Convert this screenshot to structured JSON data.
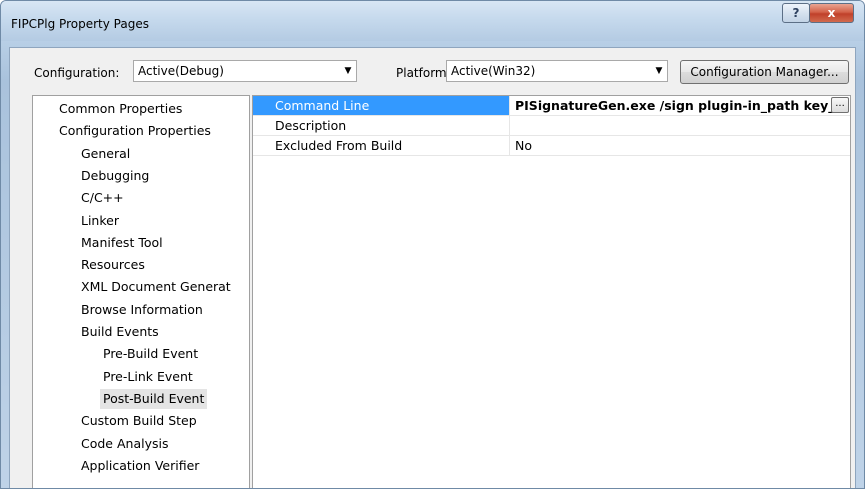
{
  "window": {
    "title": "FIPCPlg Property Pages",
    "help_glyph": "?",
    "close_glyph": "x"
  },
  "toolbar": {
    "configuration_label": "Configuration:",
    "configuration_value": "Active(Debug)",
    "platform_label": "Platform:",
    "platform_value": "Active(Win32)",
    "dropdown_arrow": "▼",
    "manager_button": "Configuration Manager..."
  },
  "tree": {
    "items": [
      {
        "label": "Common Properties",
        "level": 0
      },
      {
        "label": "Configuration Properties",
        "level": 0
      },
      {
        "label": "General",
        "level": 1
      },
      {
        "label": "Debugging",
        "level": 1
      },
      {
        "label": "C/C++",
        "level": 1
      },
      {
        "label": "Linker",
        "level": 1
      },
      {
        "label": "Manifest Tool",
        "level": 1
      },
      {
        "label": "Resources",
        "level": 1
      },
      {
        "label": "XML Document Generat",
        "level": 1
      },
      {
        "label": "Browse Information",
        "level": 1
      },
      {
        "label": "Build Events",
        "level": 1
      },
      {
        "label": "Pre-Build Event",
        "level": 2
      },
      {
        "label": "Pre-Link Event",
        "level": 2
      },
      {
        "label": "Post-Build Event",
        "level": 2,
        "selected": true
      },
      {
        "label": "Custom Build Step",
        "level": 1
      },
      {
        "label": "Code Analysis",
        "level": 1
      },
      {
        "label": "Application Verifier",
        "level": 1
      }
    ]
  },
  "properties": {
    "rows": [
      {
        "name": "Command Line",
        "value": "PISignatureGen.exe /sign plugin-in_path key_p",
        "selected": true,
        "bold": true,
        "has_ellipsis": true
      },
      {
        "name": "Description",
        "value": ""
      },
      {
        "name": "Excluded From Build",
        "value": "No"
      }
    ],
    "ellipsis_label": "..."
  },
  "colors": {
    "selection": "#3399ff",
    "tree_selection": "#e4e4e4",
    "close_button": "#c0402a"
  }
}
